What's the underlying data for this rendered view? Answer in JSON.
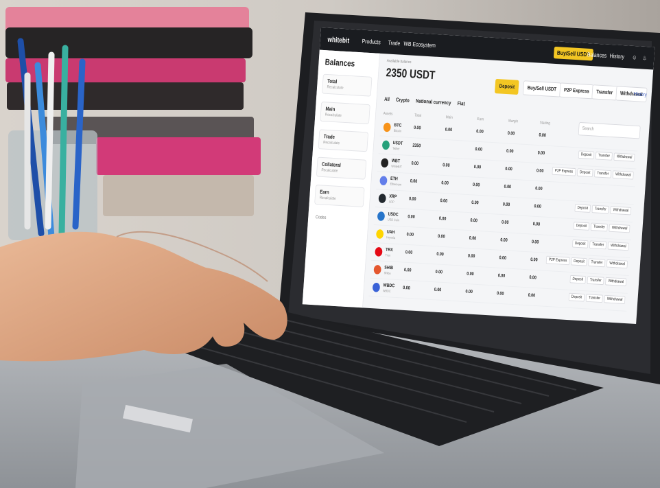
{
  "app": {
    "logo": "whitebit",
    "nav": [
      "Products",
      "Trade",
      "WB Ecosystem"
    ],
    "buy_sell": "Buy/Sell USDT",
    "balances": "Balances",
    "history": "History"
  },
  "sidebar": {
    "title": "Balances",
    "items": [
      {
        "label": "Total",
        "sub": "Recalculate"
      },
      {
        "label": "Main",
        "sub": "Recalculate"
      },
      {
        "label": "Trade",
        "sub": "Recalculate"
      },
      {
        "label": "Collateral",
        "sub": "Recalculate"
      },
      {
        "label": "Earn",
        "sub": "Recalculate"
      }
    ],
    "extra": "Codes"
  },
  "balance": {
    "caption": "Available balance",
    "amount": "2350 USDT",
    "sub": ""
  },
  "actions": {
    "deposit": "Deposit",
    "buy_sell": "Buy/Sell USDT",
    "p2p": "P2P Express",
    "transfer": "Transfer",
    "withdrawal": "Withdrawal",
    "history": "History"
  },
  "tabs": [
    "All",
    "Crypto",
    "National currency",
    "Fiat"
  ],
  "search_placeholder": "Search",
  "columns": [
    "Assets",
    "Total",
    "Main",
    "Earn",
    "Margin",
    "Staking"
  ],
  "rows": [
    {
      "sym": "BTC",
      "name": "Bitcoin",
      "color": "#f7931a",
      "vals": [
        "0.00",
        "0.00",
        "0.00",
        "0.00",
        "0.00"
      ],
      "acts": []
    },
    {
      "sym": "USDT",
      "name": "Tether",
      "color": "#26a17b",
      "vals": [
        "2350",
        "",
        "0.00",
        "0.00",
        "0.00"
      ],
      "acts": [
        "Deposit",
        "Transfer",
        "Withdrawal"
      ]
    },
    {
      "sym": "WBT",
      "name": "WhiteBIT",
      "color": "#222222",
      "vals": [
        "0.00",
        "0.00",
        "0.00",
        "0.00",
        "0.00"
      ],
      "acts": [
        "P2P Express",
        "Deposit",
        "Transfer",
        "Withdrawal"
      ]
    },
    {
      "sym": "ETH",
      "name": "Ethereum",
      "color": "#627eea",
      "vals": [
        "0.00",
        "0.00",
        "0.00",
        "0.00",
        "0.00"
      ],
      "acts": []
    },
    {
      "sym": "XRP",
      "name": "XRP",
      "color": "#23292f",
      "vals": [
        "0.00",
        "0.00",
        "0.00",
        "0.00",
        "0.00"
      ],
      "acts": [
        "Deposit",
        "Transfer",
        "Withdrawal"
      ]
    },
    {
      "sym": "USDC",
      "name": "USD Coin",
      "color": "#2775ca",
      "vals": [
        "0.00",
        "0.00",
        "0.00",
        "0.00",
        "0.00"
      ],
      "acts": [
        "Deposit",
        "Transfer",
        "Withdrawal"
      ]
    },
    {
      "sym": "UAH",
      "name": "Hryvnia",
      "color": "#ffd500",
      "vals": [
        "0.00",
        "0.00",
        "0.00",
        "0.00",
        "0.00"
      ],
      "acts": [
        "Deposit",
        "Transfer",
        "Withdrawal"
      ]
    },
    {
      "sym": "TRX",
      "name": "Tron",
      "color": "#e50915",
      "vals": [
        "0.00",
        "0.00",
        "0.00",
        "0.00",
        "0.00"
      ],
      "acts": [
        "P2P Express",
        "Deposit",
        "Transfer",
        "Withdrawal"
      ]
    },
    {
      "sym": "SHIB",
      "name": "Shiba",
      "color": "#e4572e",
      "vals": [
        "0.00",
        "0.00",
        "0.00",
        "0.00",
        "0.00"
      ],
      "acts": [
        "Deposit",
        "Transfer",
        "Withdrawal"
      ]
    },
    {
      "sym": "WBDC",
      "name": "WBDC",
      "color": "#3a62d7",
      "vals": [
        "0.00",
        "0.00",
        "0.00",
        "0.00",
        "0.00"
      ],
      "acts": [
        "Deposit",
        "Transfer",
        "Withdrawal"
      ]
    }
  ]
}
